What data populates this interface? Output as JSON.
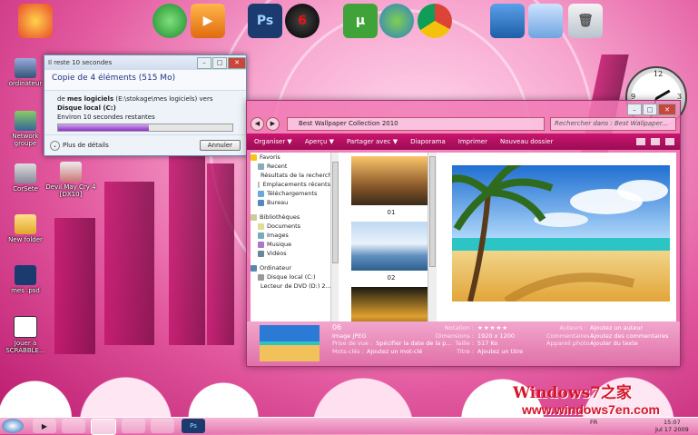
{
  "desktop": {
    "icons": [
      {
        "label": "ordinateur",
        "icon": "computer-icon"
      },
      {
        "label": "Network groupe",
        "icon": "network-users-icon"
      },
      {
        "label": "CorSete",
        "icon": "docs-icon"
      },
      {
        "label": "Devil May Cry 4 [DX10]",
        "icon": "game-icon"
      },
      {
        "label": "New folder",
        "icon": "folder-icon"
      },
      {
        "label": "mes .psd",
        "icon": "photoshop-icon"
      },
      {
        "label": "Jouer à SCRABBLE...",
        "icon": "scrabble-icon"
      }
    ]
  },
  "dock": [
    {
      "name": "start-orb-icon"
    },
    {
      "name": "windows-logo-icon"
    },
    {
      "name": "media-player-icon"
    },
    {
      "name": "photoshop-icon"
    },
    {
      "name": "audio-app-icon"
    },
    {
      "name": "utorrent-icon"
    },
    {
      "name": "messenger-icon"
    },
    {
      "name": "chrome-icon"
    },
    {
      "name": "computer-icon"
    },
    {
      "name": "control-panel-icon"
    },
    {
      "name": "recycle-bin-icon"
    }
  ],
  "copy_dialog": {
    "title": "Il reste 10 secondes",
    "heading": "Copie de 4 éléments (515 Mo)",
    "line1_prefix": "de",
    "source": "mes logiciels",
    "source_path": "(E:\\stokage\\mes logiciels) vers",
    "destination": "Disque local (C:)",
    "time_remaining": "Environ 10 secondes restantes",
    "progress": 0.52,
    "details_label": "Plus de détails",
    "cancel_label": "Annuler"
  },
  "explorer": {
    "address": "Best Wallpaper Collection 2010",
    "search_placeholder": "Rechercher dans : Best Wallpaper...",
    "toolbar": [
      "Organiser ▼",
      "Aperçu ▼",
      "Partager avec ▼",
      "Diaporama",
      "Imprimer",
      "Nouveau dossier"
    ],
    "sidebar": {
      "favorites_label": "Favoris",
      "favorites": [
        "Recent",
        "Résultats de la recherche",
        "Emplacements récents",
        "Téléchargements",
        "Bureau"
      ],
      "libraries_label": "Bibliothèques",
      "libraries": [
        "Documents",
        "Images",
        "Musique",
        "Vidéos"
      ],
      "computer_label": "Ordinateur",
      "computer": [
        "Disque local (C:)",
        "Lecteur de DVD (D:) 2..."
      ]
    },
    "files": [
      {
        "label": "01"
      },
      {
        "label": "02"
      }
    ],
    "details": {
      "name": "06",
      "type": "Image JPEG",
      "date_taken_label": "Prise de vue :",
      "date_taken": "Spécifier la date de la p...",
      "tags_label": "Mots-clés :",
      "tags": "Ajoutez un mot-clé",
      "rating_label": "Notation :",
      "rating": 5,
      "rating_stars": "★★★★★",
      "dimensions_label": "Dimensions :",
      "dimensions": "1920 x 1200",
      "size_label": "Taille :",
      "size": "517 Ko",
      "title_label": "Titre :",
      "title": "Ajoutez un titre",
      "authors_label": "Auteurs :",
      "authors": "Ajoutez un auteur",
      "comments_label": "Commentaires :",
      "comments": "Ajoutez des commentaires",
      "camera_label": "Appareil photo :",
      "camera": "Ajouter du texte"
    }
  },
  "brand": {
    "title": "Windows7之家",
    "url": "www.windows7en.com"
  },
  "taskbar": {
    "lang": "FR",
    "time": "15:07",
    "date": "Jul 17 2009"
  },
  "colors": {
    "accent": "#c9156e",
    "progress": "#8b2fc9",
    "brand_red": "#d4162a"
  }
}
